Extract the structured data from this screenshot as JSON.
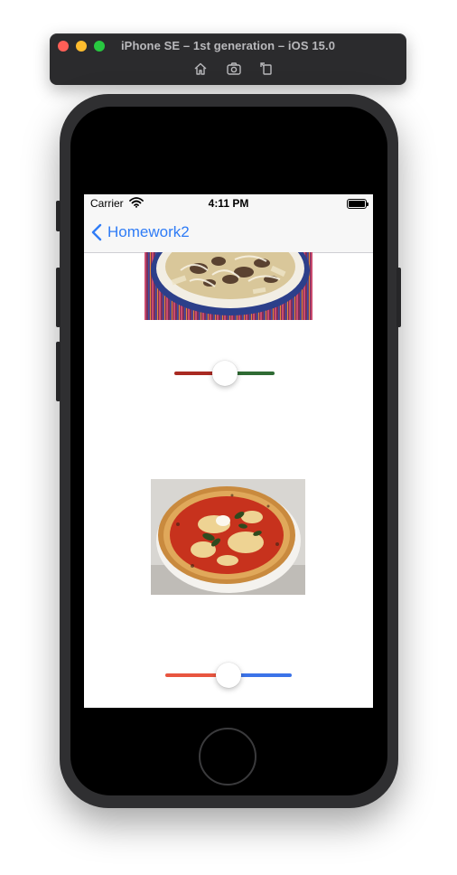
{
  "simulator": {
    "title": "iPhone SE – 1st generation – iOS 15.0",
    "tools": [
      {
        "icon": "home-icon"
      },
      {
        "icon": "screenshot-icon"
      },
      {
        "icon": "rotate-icon"
      }
    ]
  },
  "status_bar": {
    "carrier": "Carrier",
    "time": "4:11 PM"
  },
  "nav_bar": {
    "back_label": "Homework2",
    "tint": "#2f7cf6"
  },
  "images": {
    "top": {
      "subject": "pasta dish with meat and onions on plate"
    },
    "bottom": {
      "subject": "margherita pizza with basil"
    }
  },
  "sliders": {
    "top": {
      "value": 0.5,
      "min_track_color": "#a92a22",
      "max_track_color": "#2f6b34"
    },
    "bottom": {
      "value": 0.5,
      "min_track_color": "#e8553f",
      "max_track_color": "#3b73e8"
    }
  }
}
